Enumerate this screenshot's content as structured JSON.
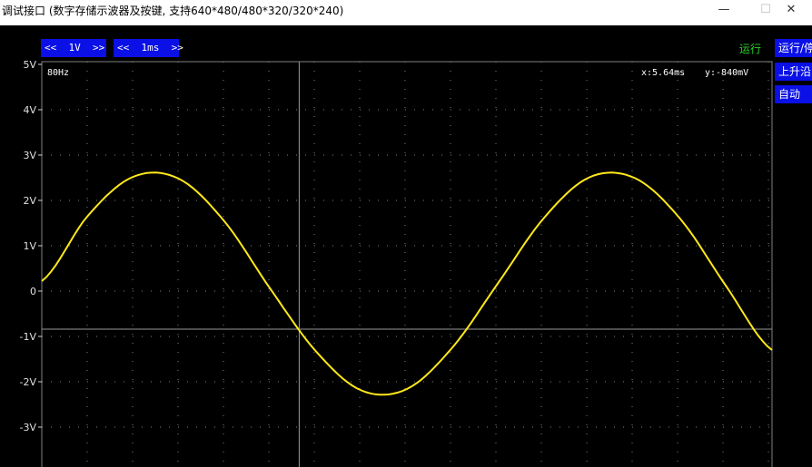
{
  "window": {
    "title": "调试接口 (数字存储示波器及按键, 支持640*480/480*320/320*240)",
    "minimize_glyph": "—",
    "maximize_glyph": "☐",
    "close_glyph": "✕"
  },
  "controls": {
    "volt_div": "<<  1V  >>",
    "time_div": "<<  1ms  >>",
    "status": "运行",
    "side_buttons": [
      "运行/停",
      "上升沿",
      "自动"
    ]
  },
  "readouts": {
    "frequency": "80Hz",
    "cursor_x": "x:5.64ms",
    "cursor_y": "y:-840mV"
  },
  "colors": {
    "background": "#000000",
    "trace": "#ffe81a",
    "grid": "#808080",
    "button": "#0a10e6",
    "status": "#28d228"
  },
  "chart_data": {
    "type": "line",
    "ylim": [
      -3.8,
      5
    ],
    "xlim": [
      0,
      16
    ],
    "y_ticks": [
      "5V",
      "4V",
      "3V",
      "2V",
      "1V",
      "0",
      "-1V",
      "-2V",
      "-3V"
    ],
    "y_tick_values": [
      5,
      4,
      3,
      2,
      1,
      0,
      -1,
      -2,
      -3
    ],
    "cursor": {
      "x": 5.64,
      "y": -0.84
    },
    "series": [
      {
        "x": [
          0,
          1,
          2,
          3,
          4,
          5,
          6,
          7,
          8,
          9,
          10,
          11,
          12,
          13,
          14,
          15,
          16
        ],
        "y": [
          0.22,
          1.65,
          2.52,
          2.48,
          1.54,
          0.06,
          -1.32,
          -2.19,
          -2.16,
          -1.24,
          0.18,
          1.61,
          2.51,
          2.49,
          1.58,
          0.1,
          -1.3
        ]
      }
    ]
  }
}
